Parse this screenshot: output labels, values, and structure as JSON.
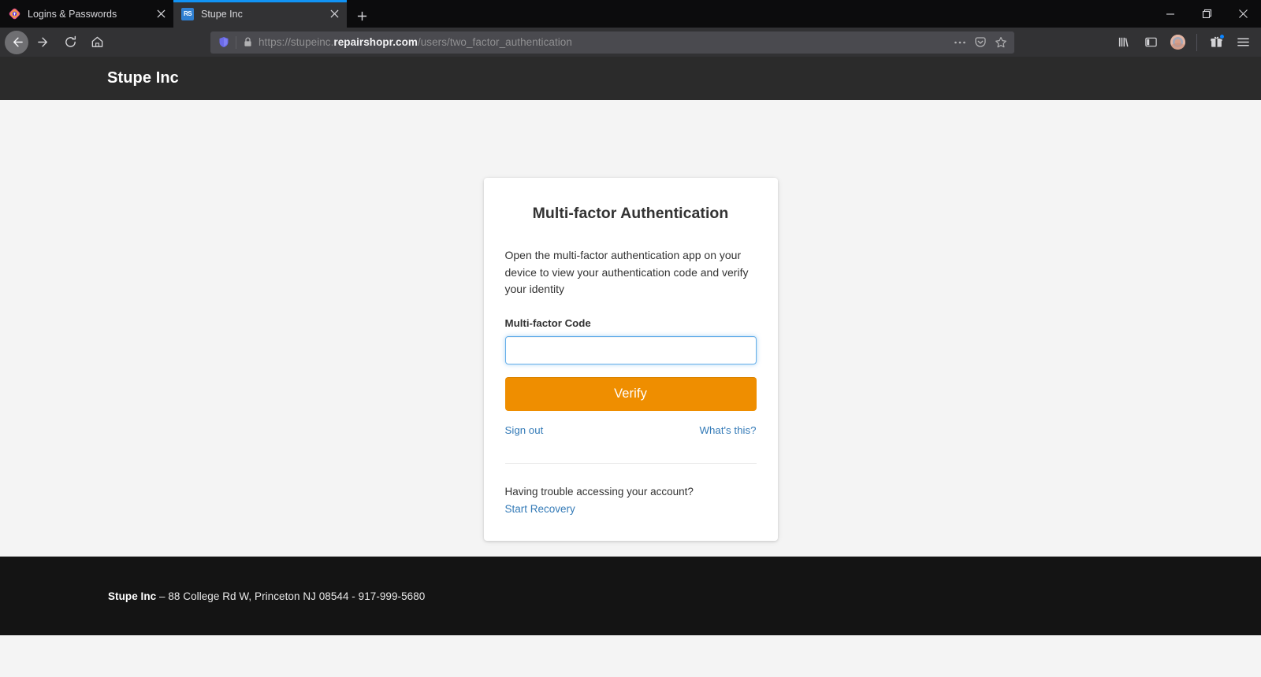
{
  "browser": {
    "tabs": [
      {
        "title": "Logins & Passwords",
        "favicon": "firefox-logins-icon",
        "active": false
      },
      {
        "title": "Stupe Inc",
        "favicon": "repairshopr-rs-icon",
        "active": true
      }
    ],
    "new_tab_label": "+",
    "window_controls": {
      "minimize": "minimize-icon",
      "restore": "restore-icon",
      "close": "close-icon"
    },
    "nav": {
      "back": "back-arrow-icon",
      "forward": "forward-arrow-icon",
      "reload": "reload-icon",
      "home": "home-icon"
    },
    "url": {
      "protocol": "https://",
      "subdomain": "stupeinc.",
      "domain": "repairshopr.com",
      "path": "/users/two_factor_authentication",
      "full": "https://stupeinc.repairshopr.com/users/two_factor_authentication",
      "shield_icon": "tracking-protection-shield-icon",
      "lock_icon": "padlock-icon",
      "page_actions_icon": "ellipsis-icon",
      "pocket_icon": "pocket-save-icon",
      "bookmark_icon": "star-bookmark-icon"
    },
    "toolbar_right": [
      {
        "name": "library-icon",
        "label": "Library"
      },
      {
        "name": "sidebar-icon",
        "label": "Sidebars"
      },
      {
        "name": "account-avatar-icon",
        "label": "Account"
      },
      {
        "name": "gift-extension-icon",
        "label": "Extension",
        "badge": true
      },
      {
        "name": "hamburger-menu-icon",
        "label": "Open menu"
      }
    ]
  },
  "page": {
    "header": {
      "brand": "Stupe Inc"
    },
    "card": {
      "title": "Multi-factor Authentication",
      "description": "Open the multi-factor authentication app on your device to view your authentication code and verify your identity",
      "field_label": "Multi-factor Code",
      "input_value": "",
      "input_placeholder": "",
      "verify_label": "Verify",
      "sign_out_label": "Sign out",
      "whats_this_label": "What's this?",
      "trouble_text": "Having trouble accessing your account?",
      "start_recovery_label": "Start Recovery"
    },
    "footer": {
      "company": "Stupe Inc",
      "address": " – 88 College Rd W, Princeton NJ 08544 - 917-999-5680"
    }
  },
  "colors": {
    "accent_orange": "#ef8e00",
    "link_blue": "#337ab7",
    "active_tab_blue": "#1193f5",
    "header_dark": "#2b2b2b",
    "footer_dark": "#141414",
    "page_bg": "#f4f4f4",
    "input_focus_blue": "#66afe9"
  }
}
